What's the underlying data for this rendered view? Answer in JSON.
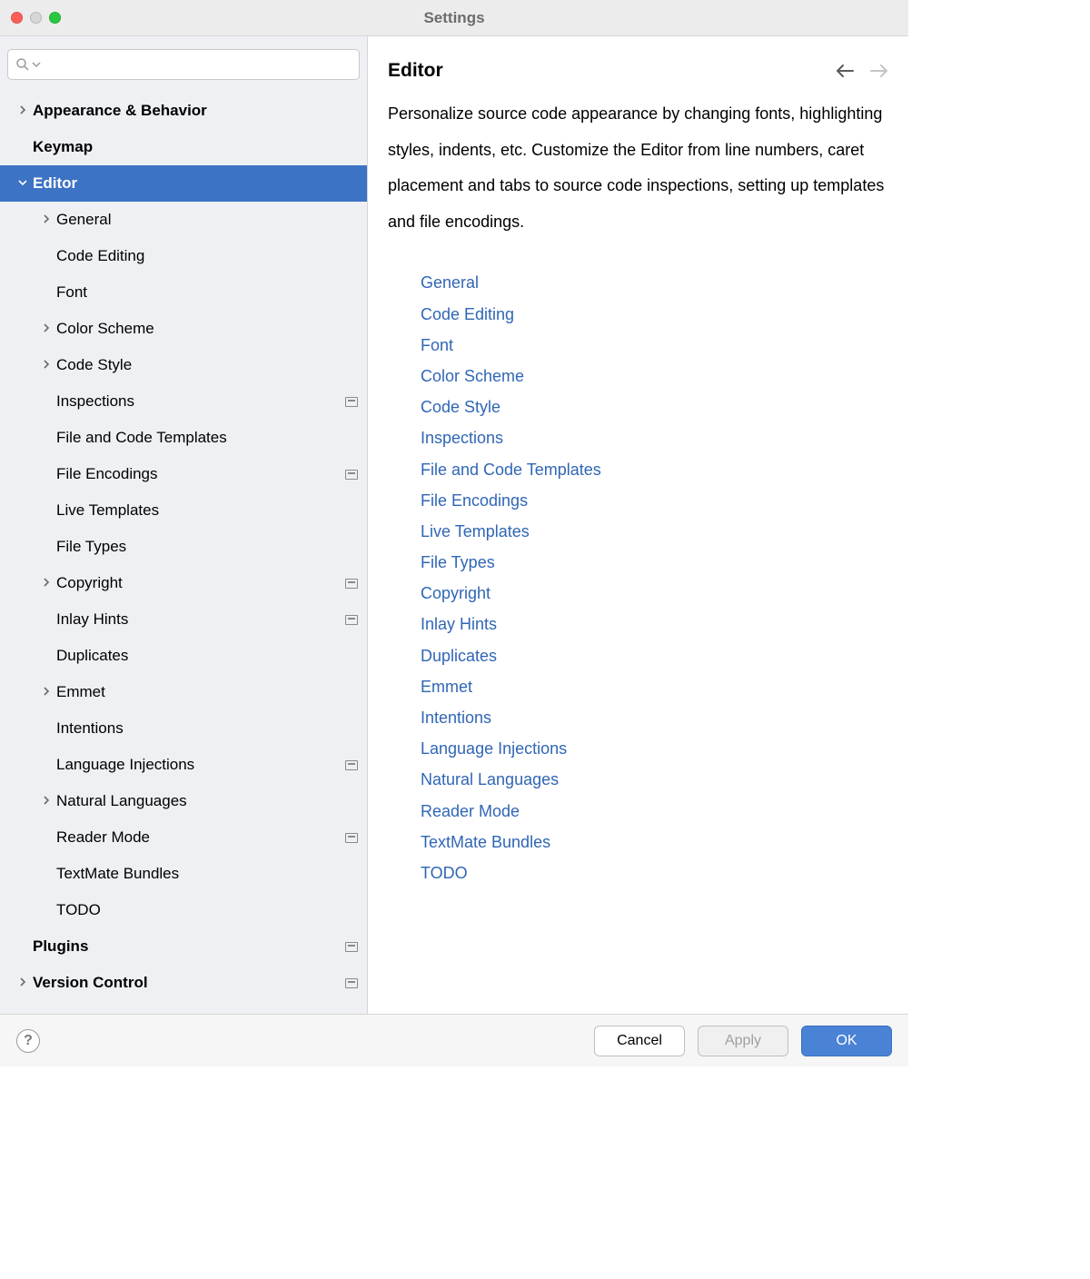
{
  "titlebar": {
    "title": "Settings"
  },
  "search": {
    "placeholder": ""
  },
  "tree": [
    {
      "id": "appearance",
      "label": "Appearance & Behavior",
      "level": 0,
      "bold": true,
      "arrow": "right",
      "selected": false,
      "badge": false
    },
    {
      "id": "keymap",
      "label": "Keymap",
      "level": 0,
      "bold": true,
      "arrow": "none",
      "selected": false,
      "badge": false
    },
    {
      "id": "editor",
      "label": "Editor",
      "level": 0,
      "bold": true,
      "arrow": "down",
      "selected": true,
      "badge": false
    },
    {
      "id": "general",
      "label": "General",
      "level": 1,
      "bold": false,
      "arrow": "right",
      "selected": false,
      "badge": false
    },
    {
      "id": "code-editing",
      "label": "Code Editing",
      "level": 1,
      "bold": false,
      "arrow": "none",
      "selected": false,
      "badge": false
    },
    {
      "id": "font",
      "label": "Font",
      "level": 1,
      "bold": false,
      "arrow": "none",
      "selected": false,
      "badge": false
    },
    {
      "id": "color-scheme",
      "label": "Color Scheme",
      "level": 1,
      "bold": false,
      "arrow": "right",
      "selected": false,
      "badge": false
    },
    {
      "id": "code-style",
      "label": "Code Style",
      "level": 1,
      "bold": false,
      "arrow": "right",
      "selected": false,
      "badge": false
    },
    {
      "id": "inspections",
      "label": "Inspections",
      "level": 1,
      "bold": false,
      "arrow": "none",
      "selected": false,
      "badge": true
    },
    {
      "id": "file-code-templates",
      "label": "File and Code Templates",
      "level": 1,
      "bold": false,
      "arrow": "none",
      "selected": false,
      "badge": false
    },
    {
      "id": "file-encodings",
      "label": "File Encodings",
      "level": 1,
      "bold": false,
      "arrow": "none",
      "selected": false,
      "badge": true
    },
    {
      "id": "live-templates",
      "label": "Live Templates",
      "level": 1,
      "bold": false,
      "arrow": "none",
      "selected": false,
      "badge": false
    },
    {
      "id": "file-types",
      "label": "File Types",
      "level": 1,
      "bold": false,
      "arrow": "none",
      "selected": false,
      "badge": false
    },
    {
      "id": "copyright",
      "label": "Copyright",
      "level": 1,
      "bold": false,
      "arrow": "right",
      "selected": false,
      "badge": true
    },
    {
      "id": "inlay-hints",
      "label": "Inlay Hints",
      "level": 1,
      "bold": false,
      "arrow": "none",
      "selected": false,
      "badge": true
    },
    {
      "id": "duplicates",
      "label": "Duplicates",
      "level": 1,
      "bold": false,
      "arrow": "none",
      "selected": false,
      "badge": false
    },
    {
      "id": "emmet",
      "label": "Emmet",
      "level": 1,
      "bold": false,
      "arrow": "right",
      "selected": false,
      "badge": false
    },
    {
      "id": "intentions",
      "label": "Intentions",
      "level": 1,
      "bold": false,
      "arrow": "none",
      "selected": false,
      "badge": false
    },
    {
      "id": "language-injections",
      "label": "Language Injections",
      "level": 1,
      "bold": false,
      "arrow": "none",
      "selected": false,
      "badge": true
    },
    {
      "id": "natural-languages",
      "label": "Natural Languages",
      "level": 1,
      "bold": false,
      "arrow": "right",
      "selected": false,
      "badge": false
    },
    {
      "id": "reader-mode",
      "label": "Reader Mode",
      "level": 1,
      "bold": false,
      "arrow": "none",
      "selected": false,
      "badge": true
    },
    {
      "id": "textmate-bundles",
      "label": "TextMate Bundles",
      "level": 1,
      "bold": false,
      "arrow": "none",
      "selected": false,
      "badge": false
    },
    {
      "id": "todo",
      "label": "TODO",
      "level": 1,
      "bold": false,
      "arrow": "none",
      "selected": false,
      "badge": false
    },
    {
      "id": "plugins",
      "label": "Plugins",
      "level": 0,
      "bold": true,
      "arrow": "none",
      "selected": false,
      "badge": true
    },
    {
      "id": "version-control",
      "label": "Version Control",
      "level": 0,
      "bold": true,
      "arrow": "right",
      "selected": false,
      "badge": true
    }
  ],
  "main": {
    "heading": "Editor",
    "description": "Personalize source code appearance by changing fonts, highlighting styles, indents, etc. Customize the Editor from line numbers, caret placement and tabs to source code inspections, setting up templates and file encodings.",
    "links": [
      "General",
      "Code Editing",
      "Font",
      "Color Scheme",
      "Code Style",
      "Inspections",
      "File and Code Templates",
      "File Encodings",
      "Live Templates",
      "File Types",
      "Copyright",
      "Inlay Hints",
      "Duplicates",
      "Emmet",
      "Intentions",
      "Language Injections",
      "Natural Languages",
      "Reader Mode",
      "TextMate Bundles",
      "TODO"
    ]
  },
  "footer": {
    "help": "?",
    "cancel": "Cancel",
    "apply": "Apply",
    "ok": "OK"
  }
}
